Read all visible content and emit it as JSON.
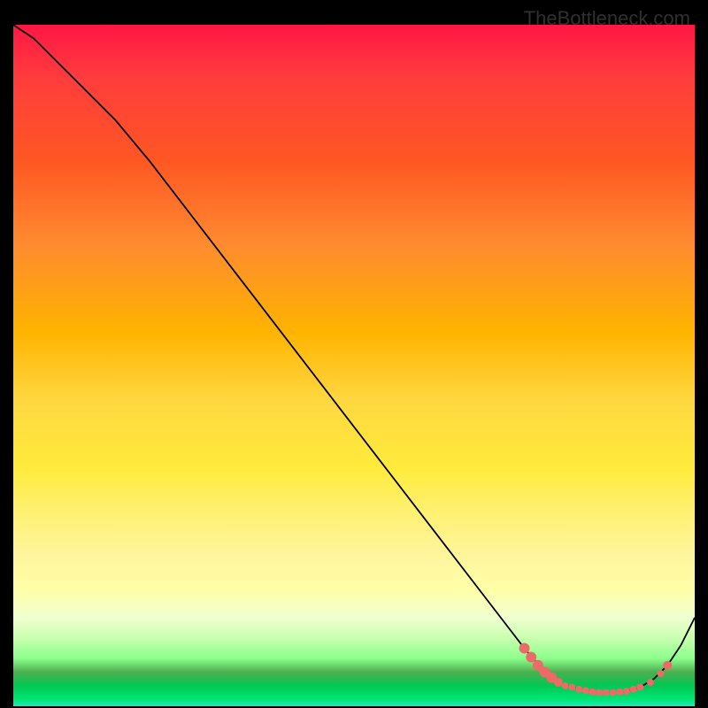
{
  "attribution": "TheBottleneck.com",
  "chart_data": {
    "type": "line",
    "title": "",
    "xlabel": "",
    "ylabel": "",
    "xlim": [
      0,
      100
    ],
    "ylim": [
      0,
      100
    ],
    "series": [
      {
        "name": "bottleneck-curve",
        "color": "#000000",
        "x": [
          0,
          3,
          6,
          10,
          15,
          20,
          30,
          40,
          50,
          60,
          70,
          75,
          78,
          80,
          82,
          84,
          86,
          88,
          90,
          92,
          94,
          96,
          98,
          100
        ],
        "y": [
          100,
          98,
          95,
          91,
          86,
          80,
          67,
          54,
          41,
          28,
          15,
          8.5,
          5,
          3.5,
          2.8,
          2.3,
          2,
          2,
          2.2,
          2.8,
          4,
          6,
          9,
          13
        ]
      },
      {
        "name": "data-points",
        "color": "#ec6b66",
        "type": "scatter",
        "points": [
          {
            "x": 75,
            "y": 8.5,
            "size": 6
          },
          {
            "x": 76,
            "y": 7.2,
            "size": 6
          },
          {
            "x": 77,
            "y": 6,
            "size": 6
          },
          {
            "x": 78,
            "y": 5,
            "size": 6
          },
          {
            "x": 79,
            "y": 4.2,
            "size": 6
          },
          {
            "x": 80,
            "y": 3.5,
            "size": 5
          },
          {
            "x": 81,
            "y": 3,
            "size": 4
          },
          {
            "x": 82,
            "y": 2.8,
            "size": 4
          },
          {
            "x": 83,
            "y": 2.5,
            "size": 4
          },
          {
            "x": 84,
            "y": 2.3,
            "size": 4
          },
          {
            "x": 85,
            "y": 2.1,
            "size": 4
          },
          {
            "x": 86,
            "y": 2,
            "size": 4
          },
          {
            "x": 87,
            "y": 2,
            "size": 4
          },
          {
            "x": 88,
            "y": 2,
            "size": 4
          },
          {
            "x": 89,
            "y": 2.1,
            "size": 4
          },
          {
            "x": 90,
            "y": 2.2,
            "size": 4
          },
          {
            "x": 91,
            "y": 2.5,
            "size": 4
          },
          {
            "x": 92,
            "y": 2.8,
            "size": 4
          },
          {
            "x": 93.5,
            "y": 3.5,
            "size": 4
          },
          {
            "x": 95,
            "y": 4.8,
            "size": 4
          },
          {
            "x": 96,
            "y": 6,
            "size": 5
          }
        ]
      }
    ]
  }
}
